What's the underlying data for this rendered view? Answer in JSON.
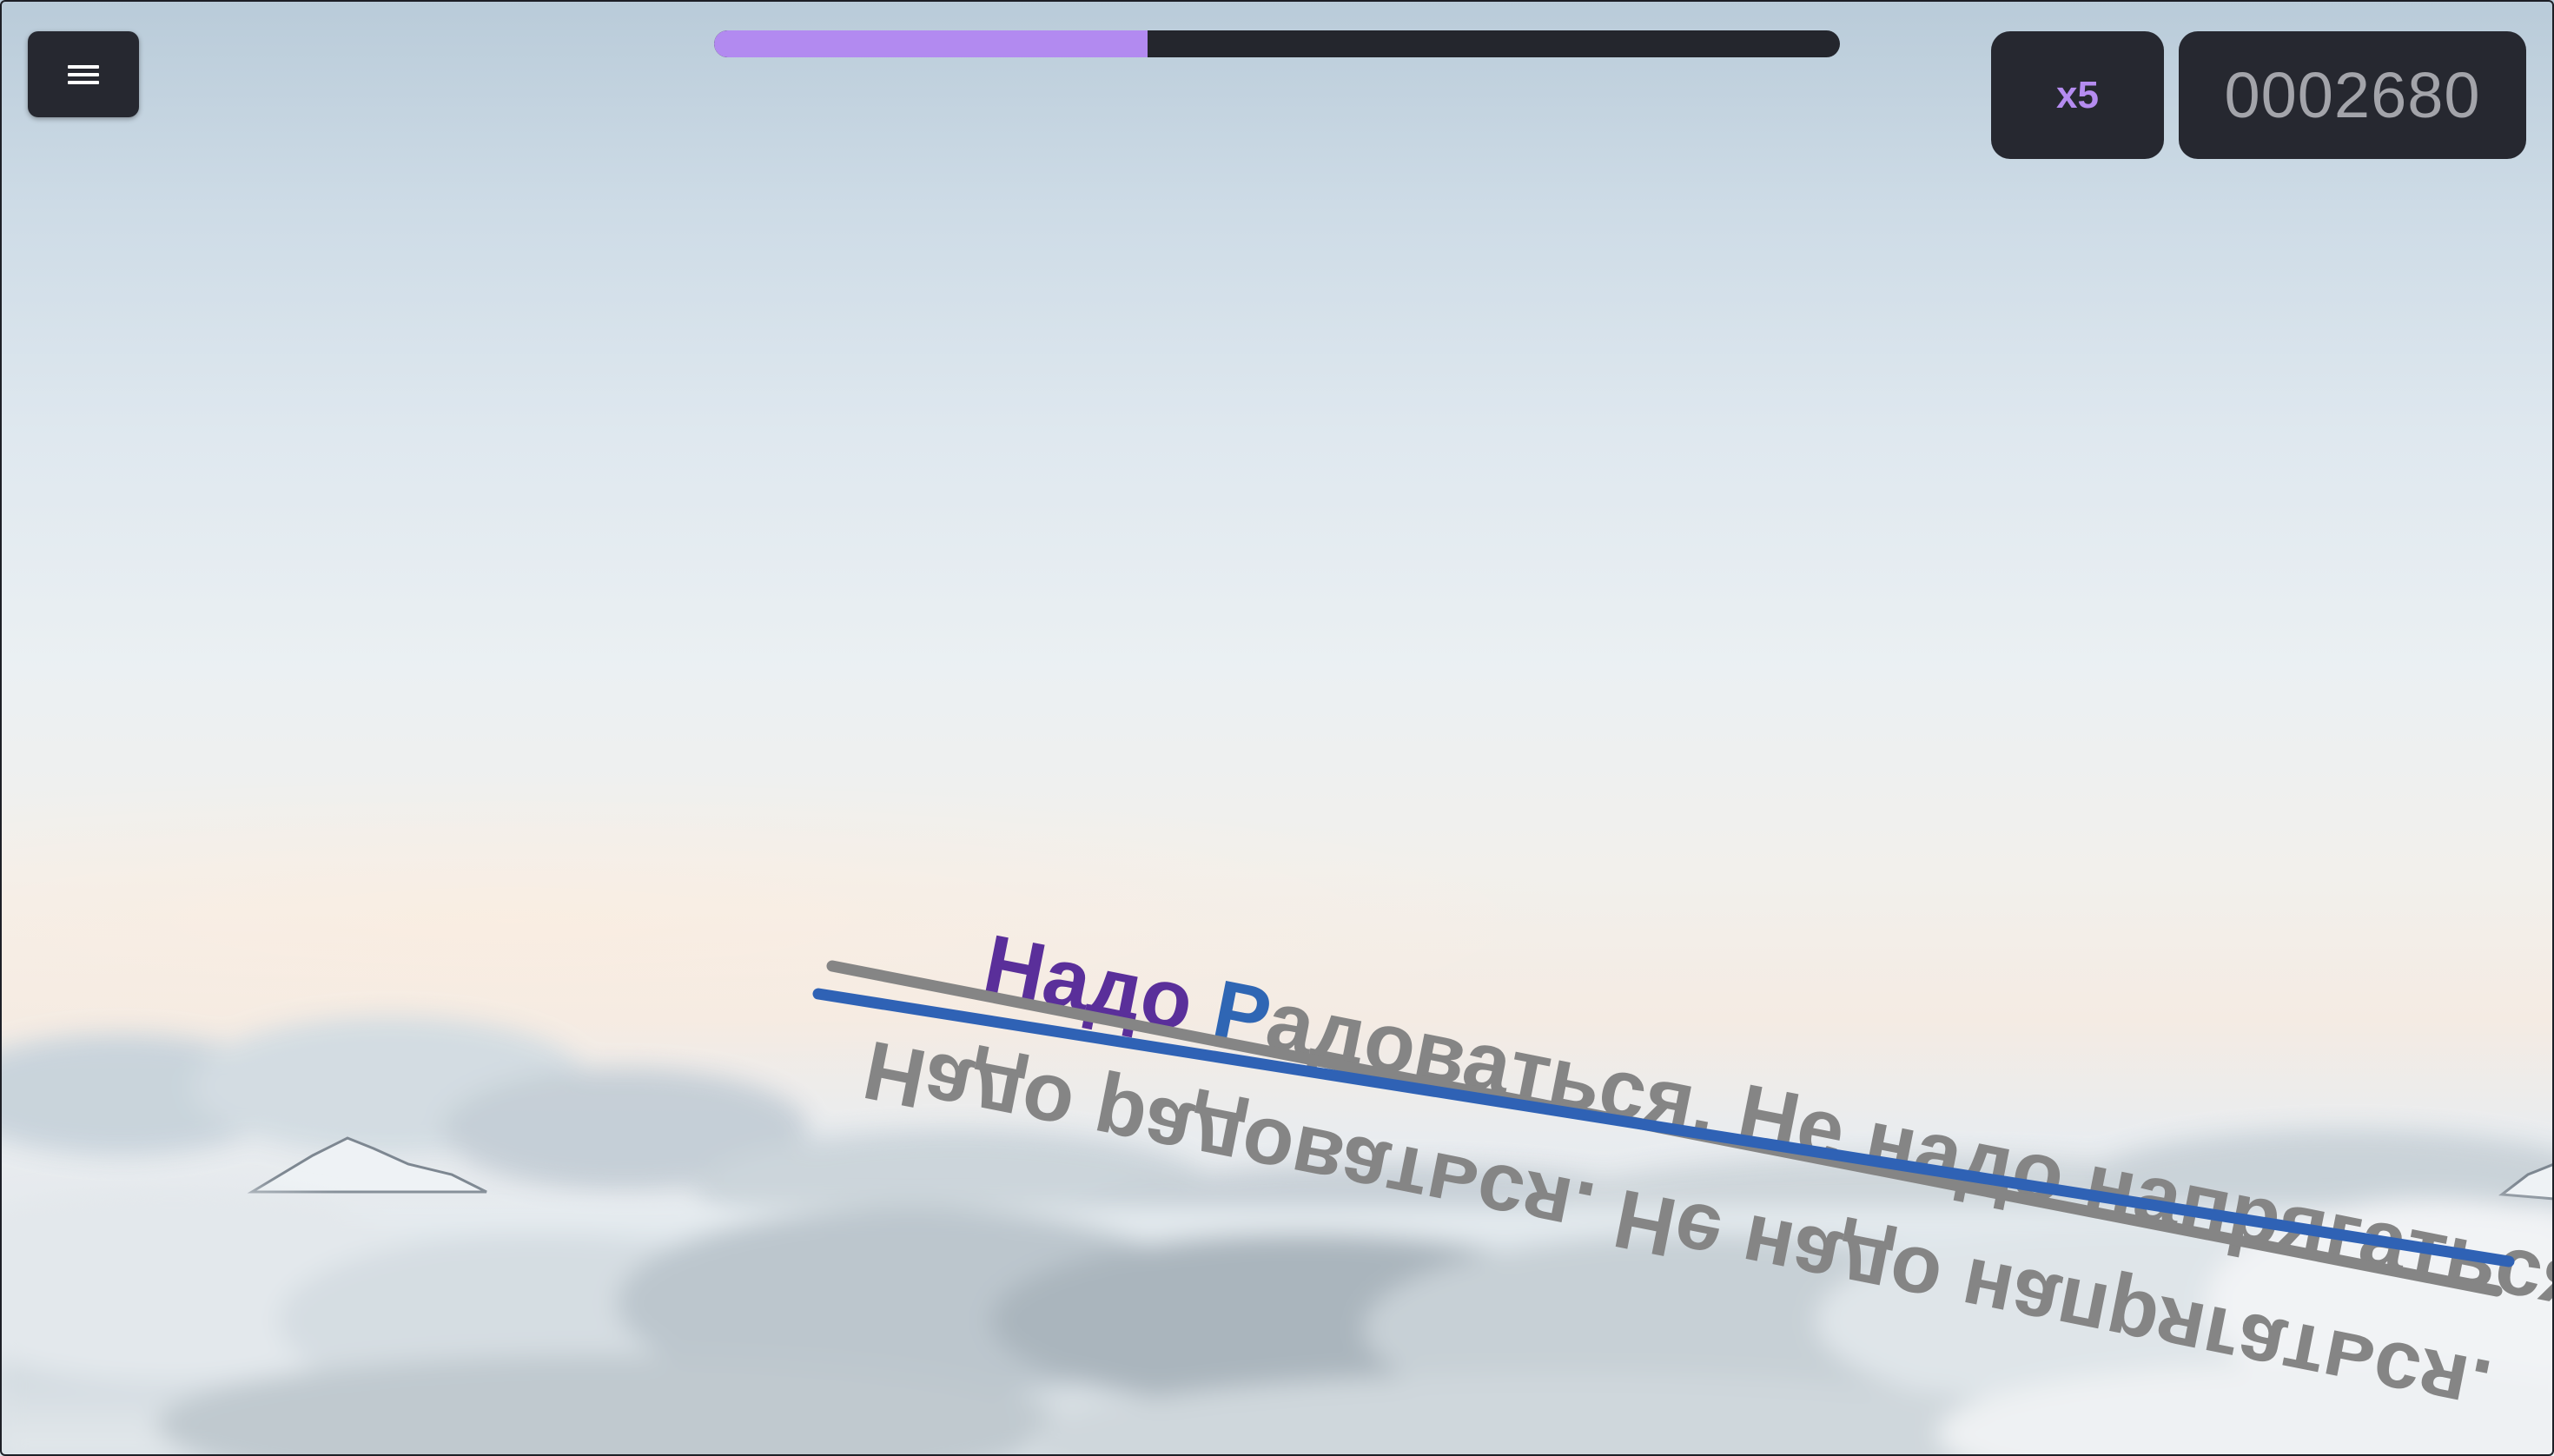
{
  "hud": {
    "menu_icon": "hamburger-menu-icon",
    "progress_fraction": 0.385,
    "multiplier": "x5",
    "score": "0002680"
  },
  "lyrics": {
    "sung": "Надо ",
    "current": "Р",
    "upcoming": "адоваться. Не надо напрягаться.",
    "mirrored": "Надо радоваться. Не надо напрягаться."
  },
  "colors": {
    "sung": "#5a2f9a",
    "current": "#2f66b4",
    "upcoming": "#858585",
    "mirrored": "#858585",
    "guide_line": "#2f62b5",
    "track_line": "#858585",
    "progress_fill": "#b28af0",
    "panel": "#262830"
  }
}
